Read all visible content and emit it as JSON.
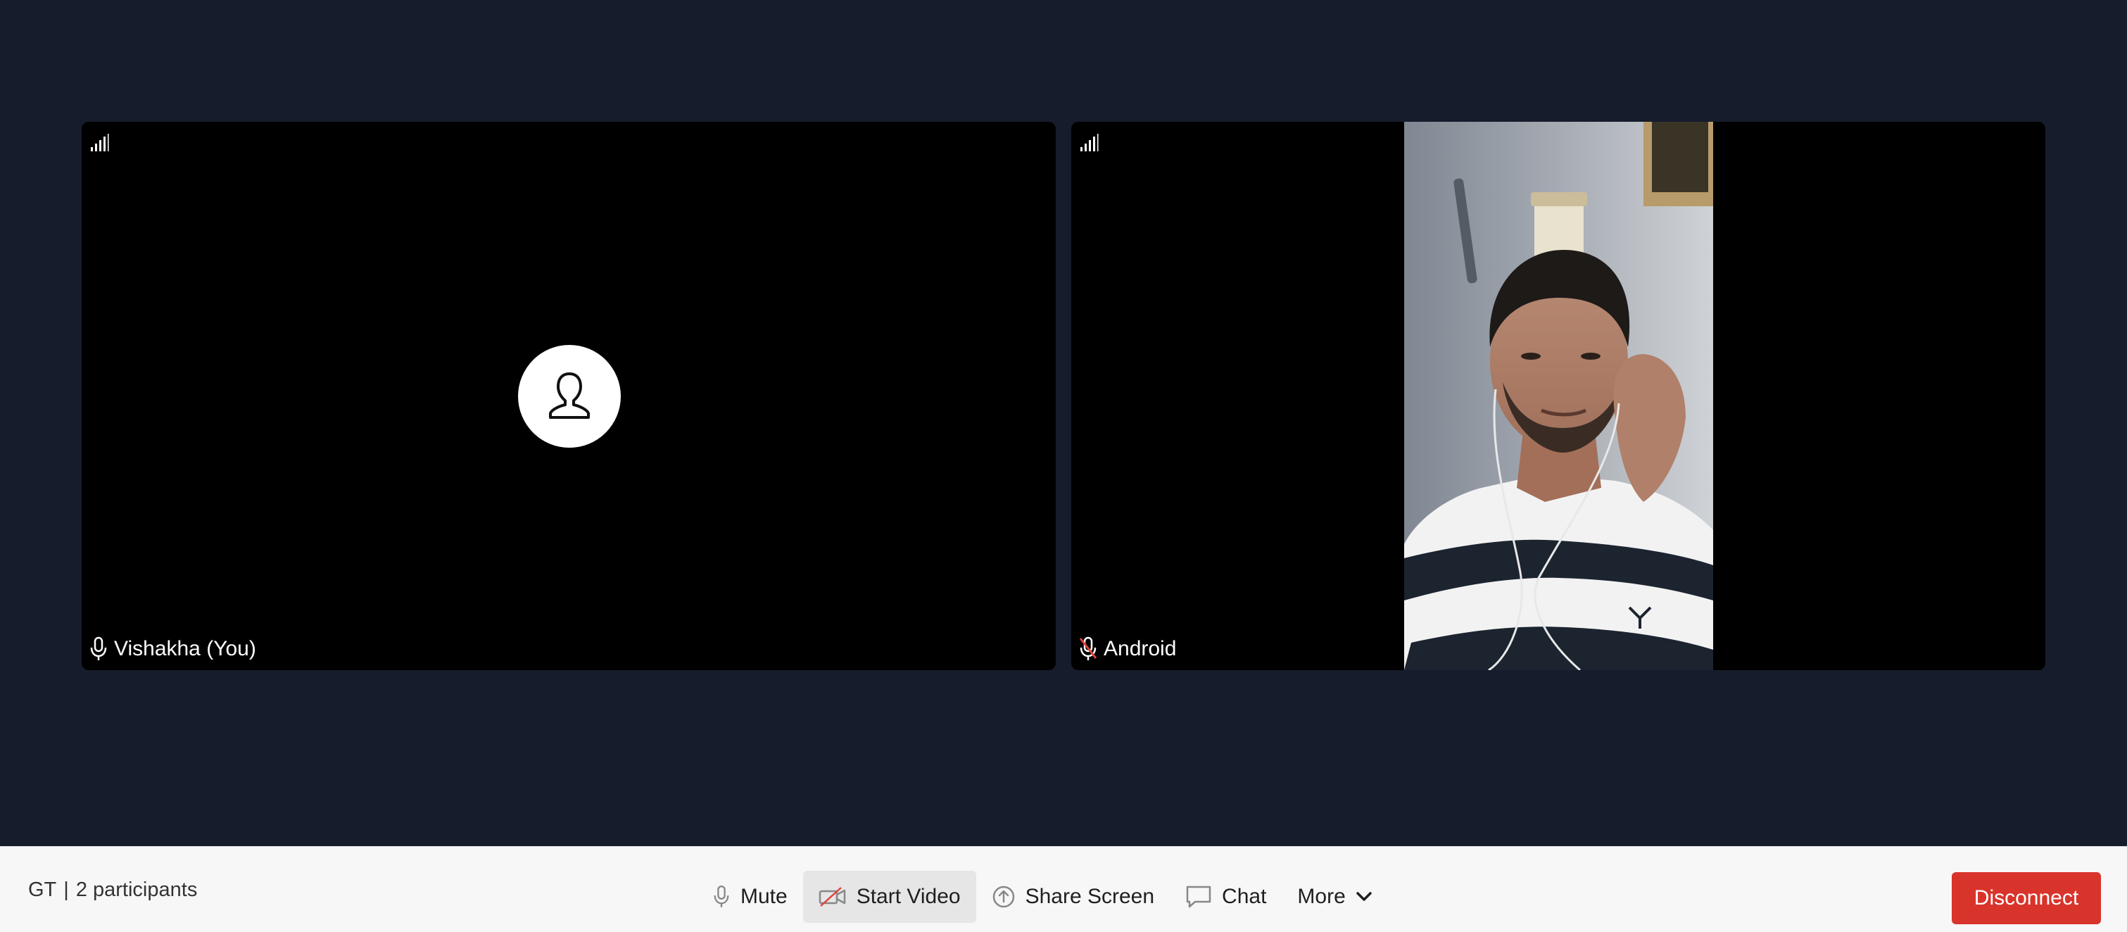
{
  "participants": [
    {
      "name": "Vishakha (You)",
      "video": "off",
      "mic": "on"
    },
    {
      "name": "Android",
      "video": "on",
      "mic": "muted"
    }
  ],
  "toolbar": {
    "meeting_code": "GT",
    "participants_label": "2 participants",
    "mute_label": "Mute",
    "start_video_label": "Start Video",
    "share_screen_label": "Share Screen",
    "chat_label": "Chat",
    "more_label": "More",
    "disconnect_label": "Disconnect"
  },
  "icons": {
    "signal": "signal-strength-icon",
    "avatar": "user-placeholder-icon",
    "mic": "microphone-icon",
    "mic_muted": "microphone-muted-icon",
    "video_off": "video-off-icon",
    "share": "share-screen-icon",
    "chat": "chat-icon",
    "chevron": "chevron-down-icon"
  },
  "colors": {
    "background": "#161c2c",
    "tile": "#000000",
    "toolbar": "#f7f7f7",
    "disconnect": "#d9342b",
    "muted_accent": "#e0443a"
  }
}
